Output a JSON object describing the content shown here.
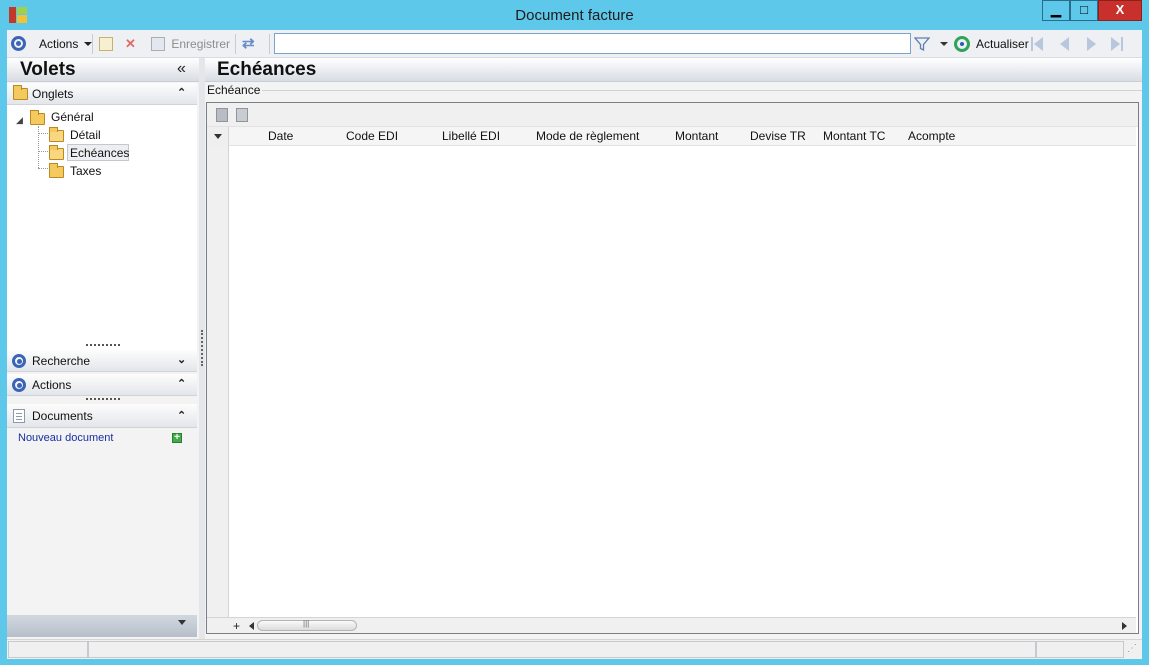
{
  "window": {
    "title": "Document facture",
    "minimize_label": "▁",
    "maximize_label": "□",
    "close_label": "X"
  },
  "toolbar": {
    "actions_label": "Actions",
    "save_label": "Enregistrer",
    "search_value": "",
    "refresh_label": "Actualiser"
  },
  "left_pane": {
    "title": "Volets",
    "collapse_glyph": "«",
    "onglets": {
      "label": "Onglets",
      "chevron": "⌃",
      "tree": {
        "root": "Général",
        "children": [
          "Détail",
          "Echéances",
          "Taxes"
        ],
        "selected": "Echéances"
      }
    },
    "recherche": {
      "label": "Recherche",
      "chevron": "⌄"
    },
    "actions": {
      "label": "Actions",
      "chevron": "⌃"
    },
    "documents": {
      "label": "Documents",
      "chevron": "⌃",
      "new_document_link": "Nouveau document"
    }
  },
  "right_pane": {
    "title": "Echéances",
    "group_label": "Echéance",
    "grid": {
      "columns": [
        "Date",
        "Code EDI",
        "Libellé EDI",
        "Mode de règlement",
        "Montant",
        "Devise TR",
        "Montant TC",
        "Acompte"
      ],
      "rows": [],
      "add_glyph": "+"
    }
  },
  "colors": {
    "window_frame": "#5ec8ea",
    "close_button": "#c7302b",
    "link": "#1a2fa0",
    "accent_icon": "#3b64b8"
  }
}
